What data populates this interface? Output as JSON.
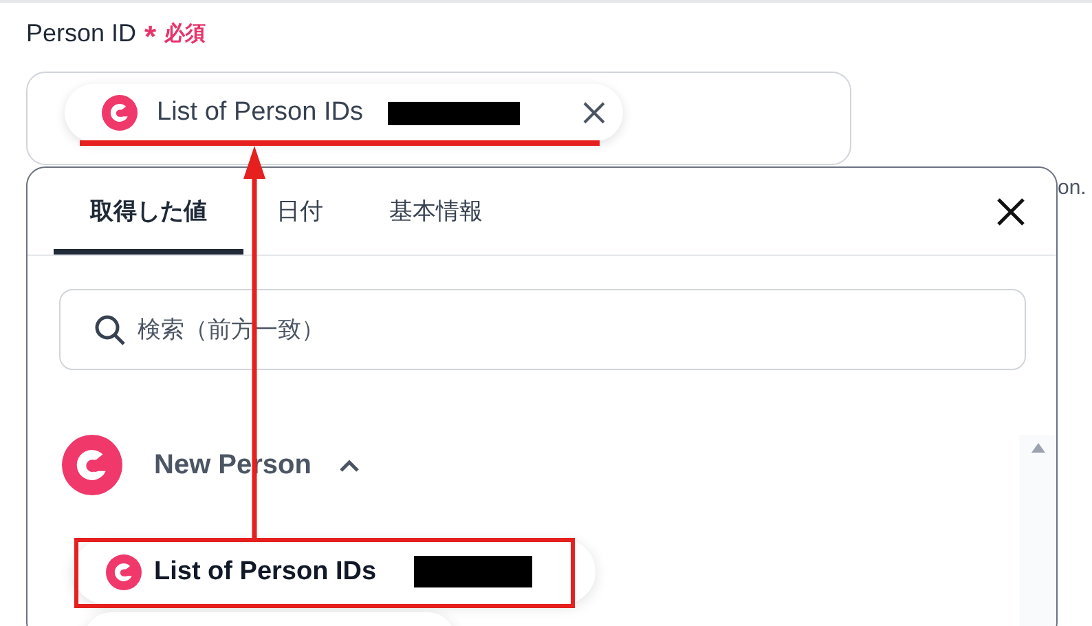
{
  "field": {
    "label": "Person ID",
    "required_mark": "*",
    "required_text": "必須",
    "chip": {
      "label": "List of Person IDs"
    }
  },
  "helper_text": "on.",
  "panel": {
    "tabs": [
      {
        "label": "取得した値",
        "selected": true
      },
      {
        "label": "日付",
        "selected": false
      },
      {
        "label": "基本情報",
        "selected": false
      }
    ],
    "search": {
      "placeholder": "検索（前方一致）"
    },
    "groups": [
      {
        "title": "New Person",
        "expanded": true,
        "items": [
          {
            "label": "List of Person IDs"
          }
        ]
      }
    ]
  }
}
